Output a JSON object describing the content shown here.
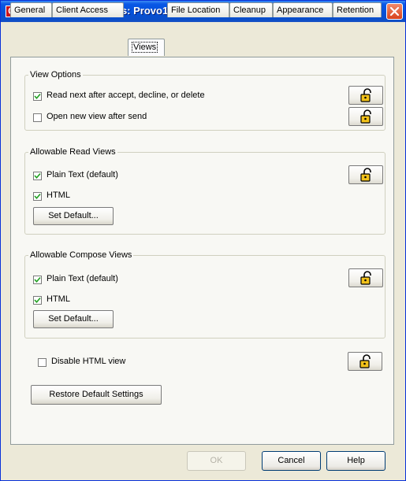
{
  "window": {
    "title": "Environment Options:  Provo1",
    "app_icon_letter": "C"
  },
  "tabs": [
    {
      "label": "General"
    },
    {
      "label": "Client Access"
    },
    {
      "label": "Views",
      "active": true
    },
    {
      "label": "File Location"
    },
    {
      "label": "Cleanup"
    },
    {
      "label": "Appearance"
    },
    {
      "label": "Retention"
    }
  ],
  "view_options": {
    "title": "View Options",
    "read_next": {
      "label": "Read next after accept, decline, or delete",
      "checked": true
    },
    "open_new_view": {
      "label": "Open new view after send",
      "checked": false
    }
  },
  "read_views": {
    "title": "Allowable Read Views",
    "plain_text": {
      "label": "Plain Text  (default)",
      "checked": true
    },
    "html": {
      "label": "HTML",
      "checked": true
    },
    "set_default_label": "Set Default..."
  },
  "compose_views": {
    "title": "Allowable Compose Views",
    "plain_text": {
      "label": "Plain Text  (default)",
      "checked": true
    },
    "html": {
      "label": "HTML",
      "checked": true
    },
    "set_default_label": "Set Default..."
  },
  "disable_html": {
    "label": "Disable HTML view",
    "checked": false
  },
  "restore_label": "Restore Default Settings",
  "footer": {
    "ok_label": "OK",
    "cancel_label": "Cancel",
    "help_label": "Help"
  },
  "colors": {
    "title_bar": "#0a58e6",
    "lock_yellow": "#f2c21a",
    "face": "#ece9d8"
  }
}
